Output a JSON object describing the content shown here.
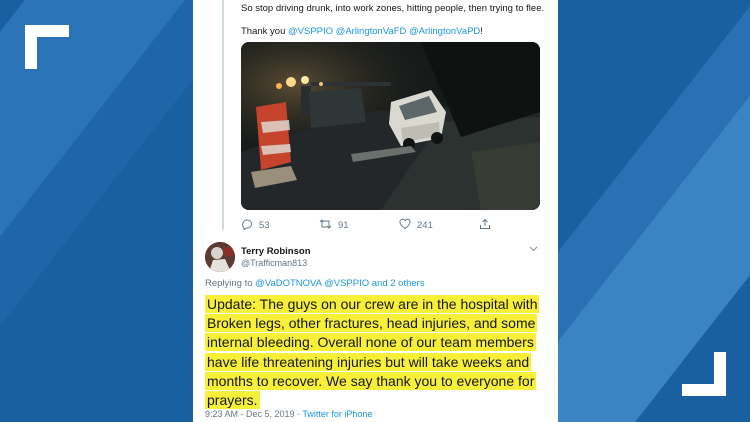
{
  "tweet_text": "So stop driving drunk, into work zones, hitting people, then trying to flee.",
  "thanks_prefix": "Thank you ",
  "mentions": [
    "@VSPPIO",
    "@ArlingtonVaFD",
    "@ArlingtonVaPD"
  ],
  "mention_suffix": "!",
  "actions": {
    "replies": "53",
    "retweets": "91",
    "likes": "241"
  },
  "reply": {
    "name": "Terry Robinson",
    "handle": "@Trafficman813",
    "replying_prefix": "Replying to ",
    "replying_mentions": "@VaDOTNOVA @VSPPIO and 2 others",
    "text": "Update: The guys on our crew are in the hospital with Broken legs, other fractures, head injuries, and some internal bleeding. Overall none of our team members have life threatening injuries but will take weeks and months to recover. We say thank you to everyone for prayers.",
    "time": "9:23 AM - Dec 5, 2019",
    "separator": " · ",
    "source": "Twitter for iPhone"
  },
  "colors": {
    "link": "#1b95e0",
    "highlight": "#f7ef38",
    "background": "#1a5fa0"
  },
  "icons": [
    "reply-icon",
    "retweet-icon",
    "like-icon",
    "share-icon",
    "chevron-down-icon"
  ]
}
